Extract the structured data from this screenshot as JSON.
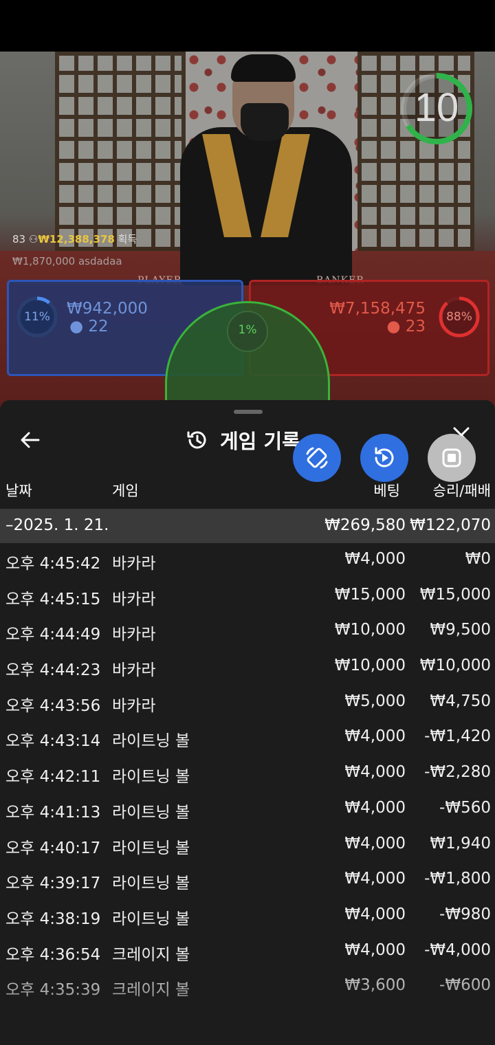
{
  "video": {
    "timer": "10",
    "table_labels": {
      "player": "PLAYER",
      "banker": "BANKER"
    },
    "winner": {
      "count": "83",
      "amount": "₩12,388,378",
      "suffix": "획득"
    },
    "recent_win": {
      "amount": "₩1,870,000",
      "user": "asdadaa"
    },
    "player_bet": {
      "percent": "11%",
      "amount": "₩942,000",
      "count": "22"
    },
    "banker_bet": {
      "percent": "88%",
      "amount": "₩7,158,475",
      "count": "23"
    },
    "tie_bet": {
      "percent": "1%"
    }
  },
  "sheet": {
    "title": "게임 기록",
    "back_icon": "arrow-left-icon",
    "close_icon": "close-icon",
    "columns": {
      "date": "날짜",
      "game": "게임",
      "bet": "베팅",
      "result": "승리/패배"
    },
    "date_group": {
      "date": "–2025. 1. 21.",
      "bet_total": "₩269,580",
      "result_total": "₩122,070"
    },
    "rows": [
      {
        "time": "오후 4:45:42",
        "game": "바카라",
        "bet": "₩4,000",
        "result": "₩0"
      },
      {
        "time": "오후 4:45:15",
        "game": "바카라",
        "bet": "₩15,000",
        "result": "₩15,000"
      },
      {
        "time": "오후 4:44:49",
        "game": "바카라",
        "bet": "₩10,000",
        "result": "₩9,500"
      },
      {
        "time": "오후 4:44:23",
        "game": "바카라",
        "bet": "₩10,000",
        "result": "₩10,000"
      },
      {
        "time": "오후 4:43:56",
        "game": "바카라",
        "bet": "₩5,000",
        "result": "₩4,750"
      },
      {
        "time": "오후 4:43:14",
        "game": "라이트닝 볼",
        "bet": "₩4,000",
        "result": "-₩1,420"
      },
      {
        "time": "오후 4:42:11",
        "game": "라이트닝 볼",
        "bet": "₩4,000",
        "result": "-₩2,280"
      },
      {
        "time": "오후 4:41:13",
        "game": "라이트닝 볼",
        "bet": "₩4,000",
        "result": "-₩560"
      },
      {
        "time": "오후 4:40:17",
        "game": "라이트닝 볼",
        "bet": "₩4,000",
        "result": "₩1,940"
      },
      {
        "time": "오후 4:39:17",
        "game": "라이트닝 볼",
        "bet": "₩4,000",
        "result": "-₩1,800"
      },
      {
        "time": "오후 4:38:19",
        "game": "라이트닝 볼",
        "bet": "₩4,000",
        "result": "-₩980"
      },
      {
        "time": "오후 4:36:54",
        "game": "크레이지 볼",
        "bet": "₩4,000",
        "result": "-₩4,000"
      },
      {
        "time": "오후 4:35:39",
        "game": "크레이지 볼",
        "bet": "₩3,600",
        "result": "-₩600"
      }
    ]
  },
  "floating_buttons": [
    {
      "icon": "rotate-screen-icon",
      "color": "#2f6fe0"
    },
    {
      "icon": "replay-icon",
      "color": "#2f6fe0"
    },
    {
      "icon": "stop-icon",
      "color": "#bdbdbd"
    }
  ],
  "colors": {
    "player": "#2d56b8",
    "banker": "#b02424",
    "tie": "#3bb33b",
    "winner_amount": "#e8c640",
    "timer_ring": "#2fb34a"
  }
}
